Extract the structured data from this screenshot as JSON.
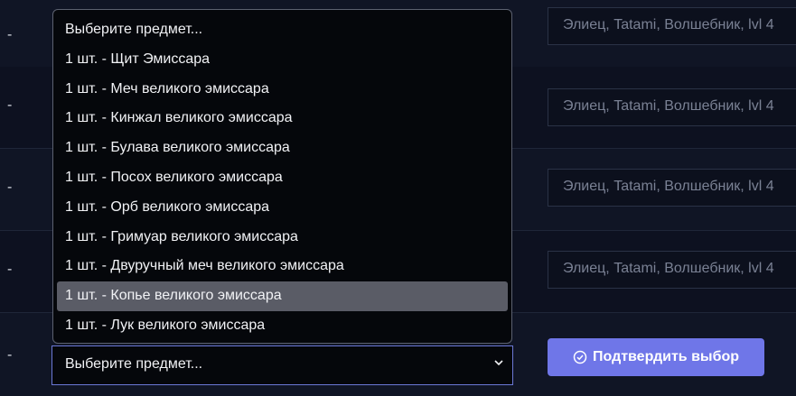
{
  "rows": [
    {
      "dash": "-",
      "player": "Элиец, Tatami, Волшебник, lvl 4"
    },
    {
      "dash": "-",
      "player": "Элиец, Tatami, Волшебник, lvl 4"
    },
    {
      "dash": "-",
      "player": "Элиец, Tatami, Волшебник, lvl 4"
    },
    {
      "dash": "-",
      "player": "Элиец, Tatami, Волшебник, lvl 4"
    },
    {
      "dash": "-"
    }
  ],
  "dropdown": {
    "options": [
      "Выберите предмет...",
      "1 шт. - Щит Эмиссара",
      "1 шт. - Меч великого эмиссара",
      "1 шт. - Кинжал великого эмиссара",
      "1 шт. - Булава великого эмиссара",
      "1 шт. - Посох великого эмиссара",
      "1 шт. - Орб великого эмиссара",
      "1 шт. - Гримуар великого эмиссара",
      "1 шт. - Двуручный меч великого эмиссара",
      "1 шт. - Копье великого эмиссара",
      "1 шт. - Лук великого эмиссара"
    ],
    "highlighted_index": 9
  },
  "select": {
    "value": "Выберите предмет..."
  },
  "confirm_button": {
    "label": "Подтвердить выбор",
    "icon": "check-circle-icon",
    "color": "#6f76e8"
  },
  "colors": {
    "background": "#0f1322",
    "accent": "#6b78d6"
  }
}
